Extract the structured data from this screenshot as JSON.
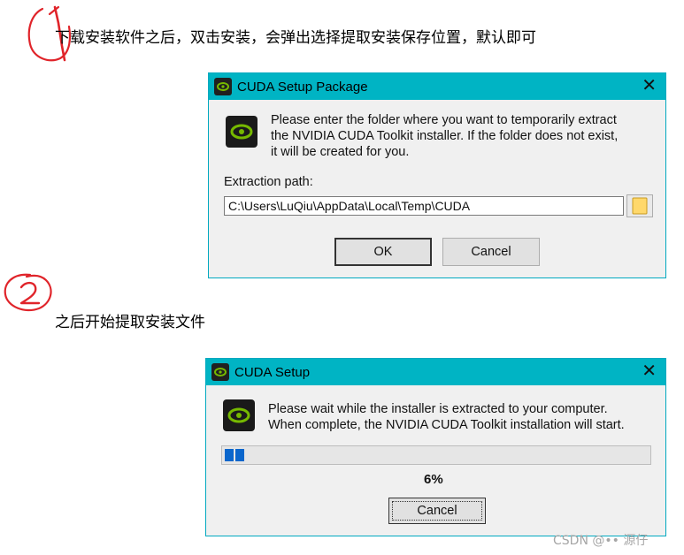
{
  "step1": {
    "text": "下载安装软件之后，双击安装，会弹出选择提取安装保存位置，默认即可"
  },
  "step2": {
    "text": "之后开始提取安装文件"
  },
  "dialog1": {
    "title": "CUDA Setup Package",
    "close_glyph": "✕",
    "message_lines": [
      "Please enter the folder where you want to temporarily extract",
      "the NVIDIA CUDA Toolkit installer. If the folder does not exist,",
      "it will be created for you."
    ],
    "path_label": "Extraction path:",
    "path_value": "C:\\Users\\LuQiu\\AppData\\Local\\Temp\\CUDA",
    "ok_label": "OK",
    "cancel_label": "Cancel",
    "folder_icon": "folder-icon"
  },
  "dialog2": {
    "title": "CUDA Setup",
    "close_glyph": "✕",
    "message_lines": [
      "Please wait while the installer is extracted to your computer.",
      "When complete, the NVIDIA CUDA Toolkit installation will start."
    ],
    "progress_percent": 6,
    "progress_text": "6%",
    "cancel_label": "Cancel"
  },
  "watermark": "CSDN @•• 源仔",
  "colors": {
    "titlebar": "#00b4c4",
    "annotation_red": "#e0242a",
    "progress_fill": "#0a66cc"
  }
}
